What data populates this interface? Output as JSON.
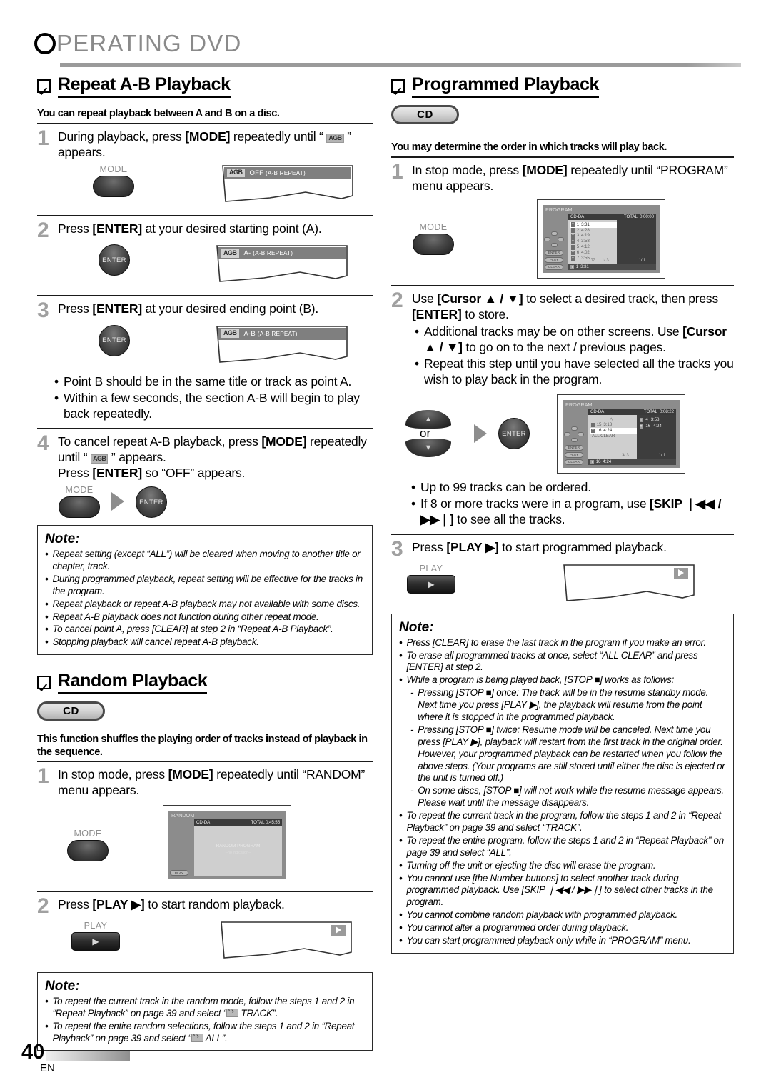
{
  "header": {
    "chapter_title": "PERATING  DVD",
    "first_letter": "O"
  },
  "left": {
    "section1": {
      "heading": "Repeat A-B Playback",
      "intro": "You can repeat playback between A and B on a disc.",
      "step1": {
        "num": "1",
        "text_a": "During playback, press ",
        "bold": "[MODE]",
        "text_b": " repeatedly until “ ",
        "icon": "AGB",
        "text_c": " ” appears.",
        "button_caption": "MODE",
        "osd_prefix": "AGB",
        "osd_label": "OFF",
        "osd_sub": "(A-B REPEAT)"
      },
      "step2": {
        "num": "2",
        "text_a": "Press ",
        "bold": "[ENTER]",
        "text_b": " at your desired starting point (A).",
        "button_label": "ENTER",
        "osd_prefix": "AGB",
        "osd_label": "A-",
        "osd_sub": "(A-B REPEAT)"
      },
      "step3": {
        "num": "3",
        "text_a": "Press ",
        "bold": "[ENTER]",
        "text_b": " at your desired ending point (B).",
        "button_label": "ENTER",
        "osd_prefix": "AGB",
        "osd_label": "A-B",
        "osd_sub": "(A-B REPEAT)",
        "bullets": [
          "Point B should be in the same title or track as point A.",
          "Within a few seconds, the section A-B will begin to play back repeatedly."
        ]
      },
      "step4": {
        "num": "4",
        "text_a": "To cancel repeat A-B playback, press ",
        "bold": "[MODE]",
        "text_b": " repeatedly until “ ",
        "icon": "AGB",
        "text_c": " ” appears.",
        "line2_a": "Press ",
        "line2_bold": "[ENTER]",
        "line2_b": " so “OFF” appears.",
        "button_caption": "MODE",
        "button2_label": "ENTER"
      },
      "note": {
        "title": "Note:",
        "items": [
          "Repeat setting (except “ALL”) will be cleared when moving to another title or chapter, track.",
          "During programmed playback, repeat setting will be effective for the tracks in the program.",
          "Repeat playback or repeat A-B playback may not available with some discs.",
          "Repeat A-B playback does not function during other repeat mode.",
          "To cancel point A, press [CLEAR] at step 2 in “Repeat A-B Playback”.",
          "Stopping playback will cancel repeat A-B playback."
        ]
      }
    },
    "section2": {
      "heading": "Random Playback",
      "badge": "CD",
      "intro": "This function shuffles the playing order of tracks instead of playback in the sequence.",
      "step1": {
        "num": "1",
        "text_a": "In stop mode, press ",
        "bold": "[MODE]",
        "text_b": " repeatedly until “RANDOM” menu appears.",
        "button_caption": "MODE"
      },
      "osd": {
        "title": "RANDOM",
        "disc_type": "CD-DA",
        "total_label": "TOTAL",
        "total_value": "0:45:55",
        "center_main": "RANDOM PROGRAM",
        "center_sub": "--no indication--",
        "buttons": [
          "PLAY"
        ]
      },
      "step2": {
        "num": "2",
        "text_a": "Press ",
        "bold": "[PLAY ▶]",
        "text_b": " to start random playback.",
        "button_caption": "PLAY"
      },
      "note": {
        "title": "Note:",
        "items": [
          "To repeat the current track in the random mode, follow the steps 1 and 2 in “Repeat Playback” on page 39 and select “  TRACK”.",
          "To repeat the entire random selections, follow the steps 1 and 2 in “Repeat Playback” on page 39 and select “  ALL”."
        ]
      }
    }
  },
  "right": {
    "section1": {
      "heading": "Programmed Playback",
      "badge": "CD",
      "intro": "You may determine the order in which tracks will play back.",
      "step1": {
        "num": "1",
        "text_a": "In stop mode, press ",
        "bold": "[MODE]",
        "text_b": " repeatedly until “PROGRAM” menu appears.",
        "button_caption": "MODE"
      },
      "osd1": {
        "title": "PROGRAM",
        "disc_type": "CD-DA",
        "total_label": "TOTAL",
        "total_value": "0:00:00",
        "tracks": [
          {
            "no": "1",
            "time": "3:31",
            "selected": true
          },
          {
            "no": "2",
            "time": "4:28",
            "selected": false
          },
          {
            "no": "3",
            "time": "4:19",
            "selected": false
          },
          {
            "no": "4",
            "time": "3:58",
            "selected": false
          },
          {
            "no": "5",
            "time": "4:12",
            "selected": false
          },
          {
            "no": "6",
            "time": "4:02",
            "selected": false
          },
          {
            "no": "7",
            "time": "3:55",
            "selected": false
          }
        ],
        "program_tracks": [],
        "page_left": "1/  3",
        "page_right": "1/  1",
        "foot_no": "1",
        "foot_time": "3:31",
        "buttons": [
          "ENTER",
          "PLAY",
          "CLEAR"
        ]
      },
      "step2": {
        "num": "2",
        "text_a": "Use ",
        "bold": "[Cursor ▲ / ▼]",
        "text_b": " to select a desired track, then press ",
        "bold2": "[ENTER]",
        "text_c": " to store.",
        "bullets": [
          {
            "a": "Additional tracks may be on other screens. Use ",
            "b": "[Cursor ▲ / ▼]",
            "c": " to go on to the next / previous pages."
          },
          {
            "a": "Repeat this step until you have selected all the tracks you wish to play back in the program.",
            "b": "",
            "c": ""
          }
        ],
        "or_label": "or",
        "button_label": "ENTER"
      },
      "osd2": {
        "title": "PROGRAM",
        "disc_type": "CD-DA",
        "total_label": "TOTAL",
        "total_value": "0:08:22",
        "tracks": [
          {
            "no": "15",
            "time": "3:18",
            "selected": false
          },
          {
            "no": "16",
            "time": "4:24",
            "selected": true
          }
        ],
        "all_clear": "ALL CLEAR",
        "program_tracks": [
          {
            "no": "4",
            "time": "3:58"
          },
          {
            "no": "16",
            "time": "4:24"
          }
        ],
        "page_left": "3/  3",
        "page_right": "1/  1",
        "foot_no": "16",
        "foot_time": "4:24",
        "buttons": [
          "ENTER",
          "PLAY",
          "CLEAR"
        ]
      },
      "bullets_after": [
        {
          "a": "Up to 99 tracks can be ordered.",
          "b": "",
          "c": ""
        },
        {
          "a": "If 8 or more tracks were in a program, use ",
          "b": "[SKIP ❘◀◀ / ▶▶❘]",
          "c": " to see all the tracks."
        }
      ],
      "step3": {
        "num": "3",
        "text_a": "Press ",
        "bold": "[PLAY ▶]",
        "text_b": " to start programmed playback.",
        "button_caption": "PLAY"
      },
      "note": {
        "title": "Note:",
        "items": [
          {
            "sub": false,
            "t": "Press [CLEAR] to erase the last track in the program if you make an error."
          },
          {
            "sub": false,
            "t": "To erase all programmed tracks at once, select “ALL CLEAR” and press [ENTER] at step 2."
          },
          {
            "sub": false,
            "t": "While a program is being played back, [STOP ■] works as follows:"
          },
          {
            "sub": true,
            "t": "Pressing [STOP ■] once: The track will be in the resume standby mode. Next time you press [PLAY ▶], the playback will resume from the point where it is stopped in the programmed playback."
          },
          {
            "sub": true,
            "t": "Pressing [STOP ■] twice: Resume mode will be canceled. Next time you press [PLAY ▶], playback will restart from the first track in the original order. However, your programmed playback can be restarted when you follow the above steps. (Your programs are still stored until either the disc is ejected or the unit is turned off.)"
          },
          {
            "sub": true,
            "t": "On some discs, [STOP ■] will not work while the resume message appears. Please wait until the message disappears."
          },
          {
            "sub": false,
            "t": "To repeat the current track in the program, follow the steps 1 and 2 in “Repeat Playback” on page 39 and select “TRACK”."
          },
          {
            "sub": false,
            "t": "To repeat the entire program, follow the steps 1 and 2 in “Repeat Playback” on page 39 and select “ALL”."
          },
          {
            "sub": false,
            "t": "Turning off the unit or ejecting the disc will erase the program."
          },
          {
            "sub": false,
            "t": "You cannot use [the Number buttons] to select another track during programmed playback. Use [SKIP ❘◀◀ / ▶▶❘] to select other tracks in the program."
          },
          {
            "sub": false,
            "t": "You cannot combine random playback with programmed playback."
          },
          {
            "sub": false,
            "t": "You cannot alter a programmed order during playback."
          },
          {
            "sub": false,
            "t": "You can start programmed playback only while in “PROGRAM” menu."
          }
        ]
      }
    }
  },
  "footer": {
    "page_number": "40",
    "language": "EN"
  }
}
